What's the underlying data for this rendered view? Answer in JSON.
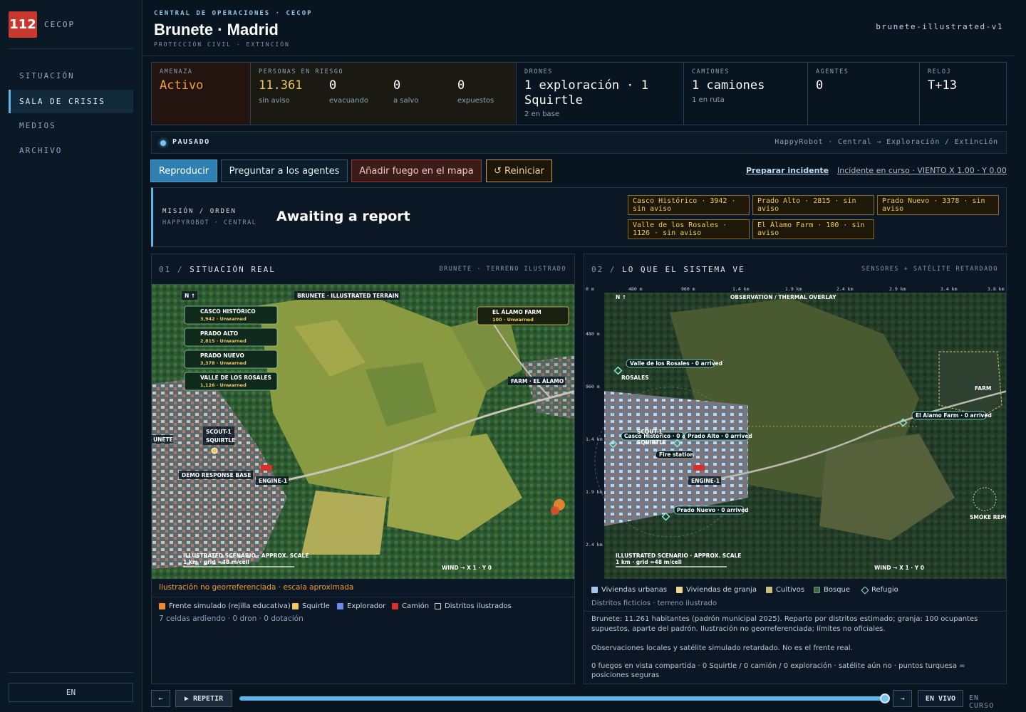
{
  "sidebar": {
    "logo_number": "112",
    "logo_text": "CECOP",
    "nav": [
      {
        "label": "SITUACIÓN",
        "active": false
      },
      {
        "label": "SALA DE CRISIS",
        "active": true
      },
      {
        "label": "MEDIOS",
        "active": false
      },
      {
        "label": "ARCHIVO",
        "active": false
      }
    ],
    "lang": "EN"
  },
  "header": {
    "kicker": "CENTRAL DE OPERACIONES · CECOP",
    "title": "Brunete · Madrid",
    "subtitle": "PROTECCIÓN CIVIL · EXTINCIÓN",
    "scenario_id": "brunete-illustrated-v1"
  },
  "stats": {
    "threat": {
      "label": "AMENAZA",
      "value": "Activo",
      "color": "#f0a030"
    },
    "people": {
      "label": "PERSONAS EN RIESGO",
      "cells": [
        {
          "value": "11.361",
          "caption": "sin aviso"
        },
        {
          "value": "0",
          "caption": "evacuando"
        },
        {
          "value": "0",
          "caption": "a salvo"
        },
        {
          "value": "0",
          "caption": "expuestos"
        }
      ]
    },
    "drones": {
      "label": "DRONES",
      "value": "1 exploración · 1 Squirtle",
      "caption": "2 en base"
    },
    "trucks": {
      "label": "CAMIONES",
      "value": "1 camiones",
      "caption": "1 en ruta"
    },
    "agents": {
      "label": "AGENTES",
      "value": "0"
    },
    "clock": {
      "label": "RELOJ",
      "value": "T+13"
    }
  },
  "status": {
    "state": "PAUSADO",
    "pipeline": "HappyRobot · Central → Exploración / Extinción"
  },
  "controls": {
    "play": "Reproducir",
    "ask": "Preguntar a los agentes",
    "add_fire": "Añadir fuego en el mapa",
    "reset": "↺ Reiniciar",
    "prepare": "Preparar incidente",
    "incident": "Incidente en curso · VIENTO X 1.00 · Y 0.00"
  },
  "mission": {
    "label": "MISIÓN / ORDEN",
    "source": "HAPPYROBOT · CENTRAL",
    "text": "Awaiting a report",
    "chips": [
      "Casco Histórico · 3942 · sin aviso",
      "Prado Alto · 2815 · sin aviso",
      "Prado Nuevo · 3378 · sin aviso",
      "Valle de los Rosales · 1126 · sin aviso",
      "El Álamo Farm · 100 · sin aviso"
    ]
  },
  "panel_real": {
    "num": "01 /",
    "title": "SITUACIÓN REAL",
    "tag": "BRUNETE · TERRENO ILUSTRADO",
    "map": {
      "north": "N ↑",
      "title": "BRUNETE · ILLUSTRATED TERRAIN",
      "districts": [
        {
          "name": "CASCO HISTÓRICO",
          "status": "3,942 · Unwarned"
        },
        {
          "name": "PRADO ALTO",
          "status": "2,815 · Unwarned"
        },
        {
          "name": "PRADO NUEVO",
          "status": "3,378 · Unwarned"
        },
        {
          "name": "VALLE DE LOS ROSALES",
          "status": "1,126 · Unwarned"
        }
      ],
      "farm": {
        "name": "EL ÁLAMO FARM",
        "status": "100 · Unwarned"
      },
      "farm_label": "FARM · EL ÁLAMO",
      "town_edge": "UNETE",
      "scout": "SCOUT-1",
      "squirtle": "SQUIRTLE",
      "base": "DEMO RESPONSE BASE",
      "engine": "ENGINE-1",
      "scale_1": "ILLUSTRATED SCENARIO · APPROX. SCALE",
      "scale_2": "1 km · grid ≈48 m/cell",
      "wind": "WIND → X 1 · Y 0"
    },
    "note": "Ilustración no georreferenciada · escala aproximada",
    "legend": [
      {
        "label": "Frente simulado (rejilla educativa)",
        "color": "#f08a30"
      },
      {
        "label": "Squirtle",
        "color": "#f0c860"
      },
      {
        "label": "Explorador",
        "color": "#6a8cf0"
      },
      {
        "label": "Camión",
        "color": "#d8302a"
      },
      {
        "label": "Distritos ilustrados",
        "color": ""
      }
    ],
    "footer": "7 celdas ardiendo · 0 dron · 0 dotación"
  },
  "panel_system": {
    "num": "02 /",
    "title": "LO QUE EL SISTEMA VE",
    "tag": "SENSORES + SATÉLITE RETARDADO",
    "map": {
      "top_ticks": [
        "0 m",
        "480 m",
        "960 m",
        "1.4 km",
        "1.9 km",
        "2.4 km",
        "2.9 km",
        "3.4 km",
        "3.8 km"
      ],
      "left_ticks": [
        "480 m",
        "960 m",
        "1.4 km",
        "1.9 km",
        "2.4 km"
      ],
      "north": "N ↑",
      "title": "OBSERVATION / THERMAL OVERLAY",
      "rosales": "ROSALES",
      "farm": "FARM",
      "smoke": "SMOKE REPO",
      "scout": "SCOUT-1",
      "squirtle": "SQUIRTLE",
      "engine": "ENGINE-1",
      "arrived": [
        "Valle de los Rosales · 0 arrived",
        "El Alamo Farm · 0 arrived",
        "Casco Histórico · 0 arr",
        "Prado Alto · 0 arrived",
        "Prado Nuevo · 0 arrived"
      ],
      "fire_station": "Fire station",
      "scale_1": "ILLUSTRATED SCENARIO · APPROX. SCALE",
      "scale_2": "1 km · grid ≈48 m/cell",
      "wind": "WIND → X 1 · Y 0"
    },
    "legend": [
      {
        "label": "Viviendas urbanas",
        "color": "#a8c4f0"
      },
      {
        "label": "Viviendas de granja",
        "color": "#f0d890"
      },
      {
        "label": "Cultivos",
        "color": "#c8c080"
      },
      {
        "label": "Bosque",
        "color": "#3a6a48"
      },
      {
        "label": "Refugio",
        "color": "#8ae8d0"
      }
    ],
    "note": "Distritos ficticios · terreno ilustrado",
    "desc_1": "Brunete: 11.261 habitantes (padrón municipal 2025). Reparto por distritos estimado; granja: 100 ocupantes supuestos, aparte del padrón. Ilustración no georreferenciada; límites no oficiales.",
    "desc_2": "Observaciones locales y satélite simulado retardado. No es el frente real.",
    "desc_3": "0 fuegos en vista compartida · 0 Squirtle / 0 camión / 0 exploración · satélite aún no · puntos turquesa = posiciones seguras"
  },
  "timeline": {
    "prev": "←",
    "repeat": "▶ REPETIR",
    "next": "→",
    "live": "EN VIVO",
    "state": "EN CURSO",
    "progress": 1.0
  }
}
